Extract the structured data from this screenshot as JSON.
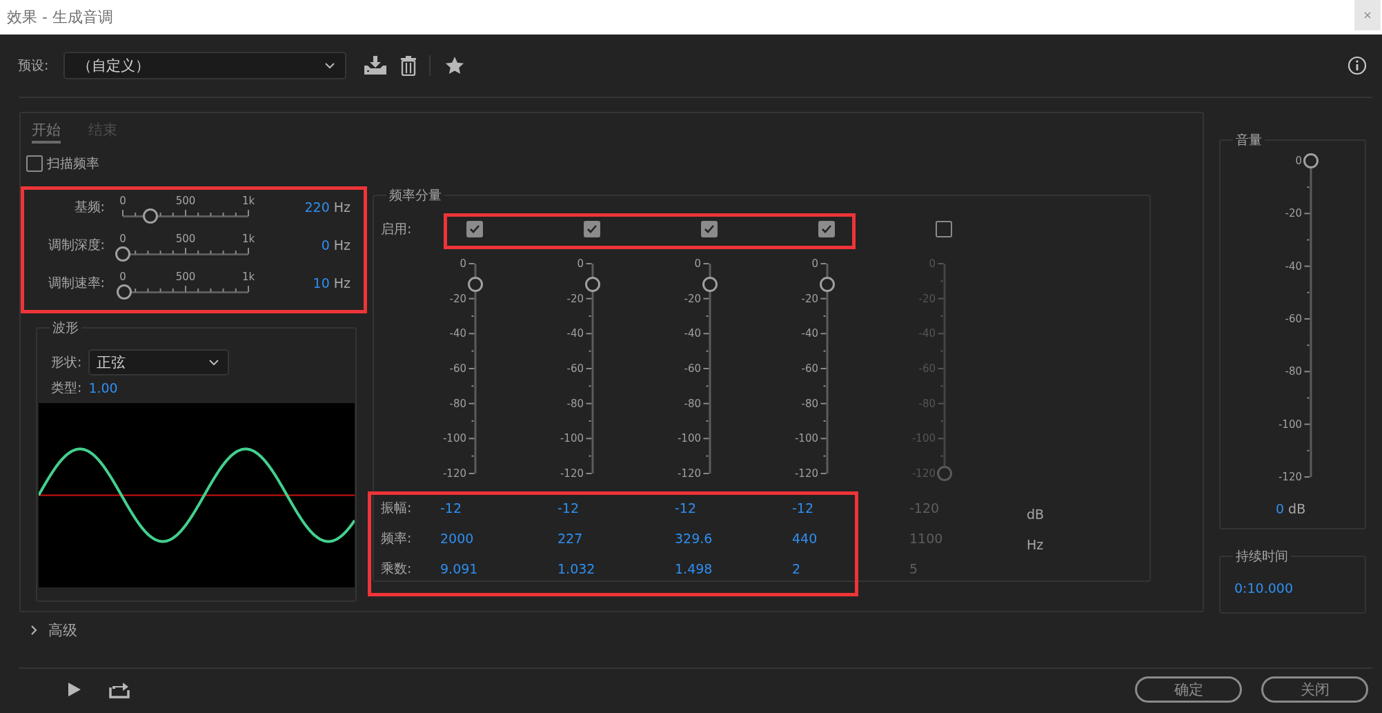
{
  "window": {
    "title": "效果 - 生成音调"
  },
  "preset": {
    "label": "预设:",
    "value": "（自定义）"
  },
  "tabs": [
    {
      "label": "开始",
      "selected": true
    },
    {
      "label": "结束",
      "selected": false
    }
  ],
  "sweep": {
    "label": "扫描频率",
    "checked": false
  },
  "base_sliders": [
    {
      "label": "基频:",
      "ticks": [
        "0",
        "500",
        "1k"
      ],
      "level": 0.22,
      "value": "220",
      "unit": "Hz"
    },
    {
      "label": "调制深度:",
      "ticks": [
        "0",
        "500",
        "1k"
      ],
      "level": 0,
      "value": "0",
      "unit": "Hz"
    },
    {
      "label": "调制速率:",
      "ticks": [
        "0",
        "500",
        "1k"
      ],
      "level": 0.01,
      "value": "10",
      "unit": "Hz"
    }
  ],
  "waveform": {
    "title": "波形",
    "shape_label": "形状:",
    "shape": "正弦",
    "type_label": "类型:",
    "type": "1.00"
  },
  "components": {
    "title": "频率分量",
    "enable_label": "启用:",
    "row_labels": [
      "振幅:",
      "频率:",
      "乘数:"
    ],
    "units": [
      "dB",
      "Hz"
    ],
    "columns": [
      {
        "checked": true,
        "scale": [
          "0",
          "-20",
          "-40",
          "-60",
          "-80",
          "-100",
          "-120"
        ],
        "level": 0.9,
        "amplitude": "-12",
        "frequency": "2000",
        "multiplier": "9.091"
      },
      {
        "checked": true,
        "scale": [
          "0",
          "-20",
          "-40",
          "-60",
          "-80",
          "-100",
          "-120"
        ],
        "level": 0.9,
        "amplitude": "-12",
        "frequency": "227",
        "multiplier": "1.032"
      },
      {
        "checked": true,
        "scale": [
          "0",
          "-20",
          "-40",
          "-60",
          "-80",
          "-100",
          "-120"
        ],
        "level": 0.9,
        "amplitude": "-12",
        "frequency": "329.6",
        "multiplier": "1.498"
      },
      {
        "checked": true,
        "scale": [
          "0",
          "-20",
          "-40",
          "-60",
          "-80",
          "-100",
          "-120"
        ],
        "level": 0.9,
        "amplitude": "-12",
        "frequency": "440",
        "multiplier": "2"
      },
      {
        "checked": false,
        "scale": [
          "0",
          "-20",
          "-40",
          "-60",
          "-80",
          "-100",
          "-120"
        ],
        "level": 0,
        "amplitude": "-120",
        "frequency": "1100",
        "multiplier": "5"
      }
    ]
  },
  "volume": {
    "title": "音量",
    "scale": [
      "0",
      "-20",
      "-40",
      "-60",
      "-80",
      "-100",
      "-120"
    ],
    "level": 1,
    "value": "0",
    "unit": "dB"
  },
  "duration": {
    "title": "持续时间",
    "value": "0:10.000"
  },
  "advanced": {
    "label": "高级",
    "expanded": false
  },
  "buttons": [
    "确定",
    "关闭"
  ]
}
